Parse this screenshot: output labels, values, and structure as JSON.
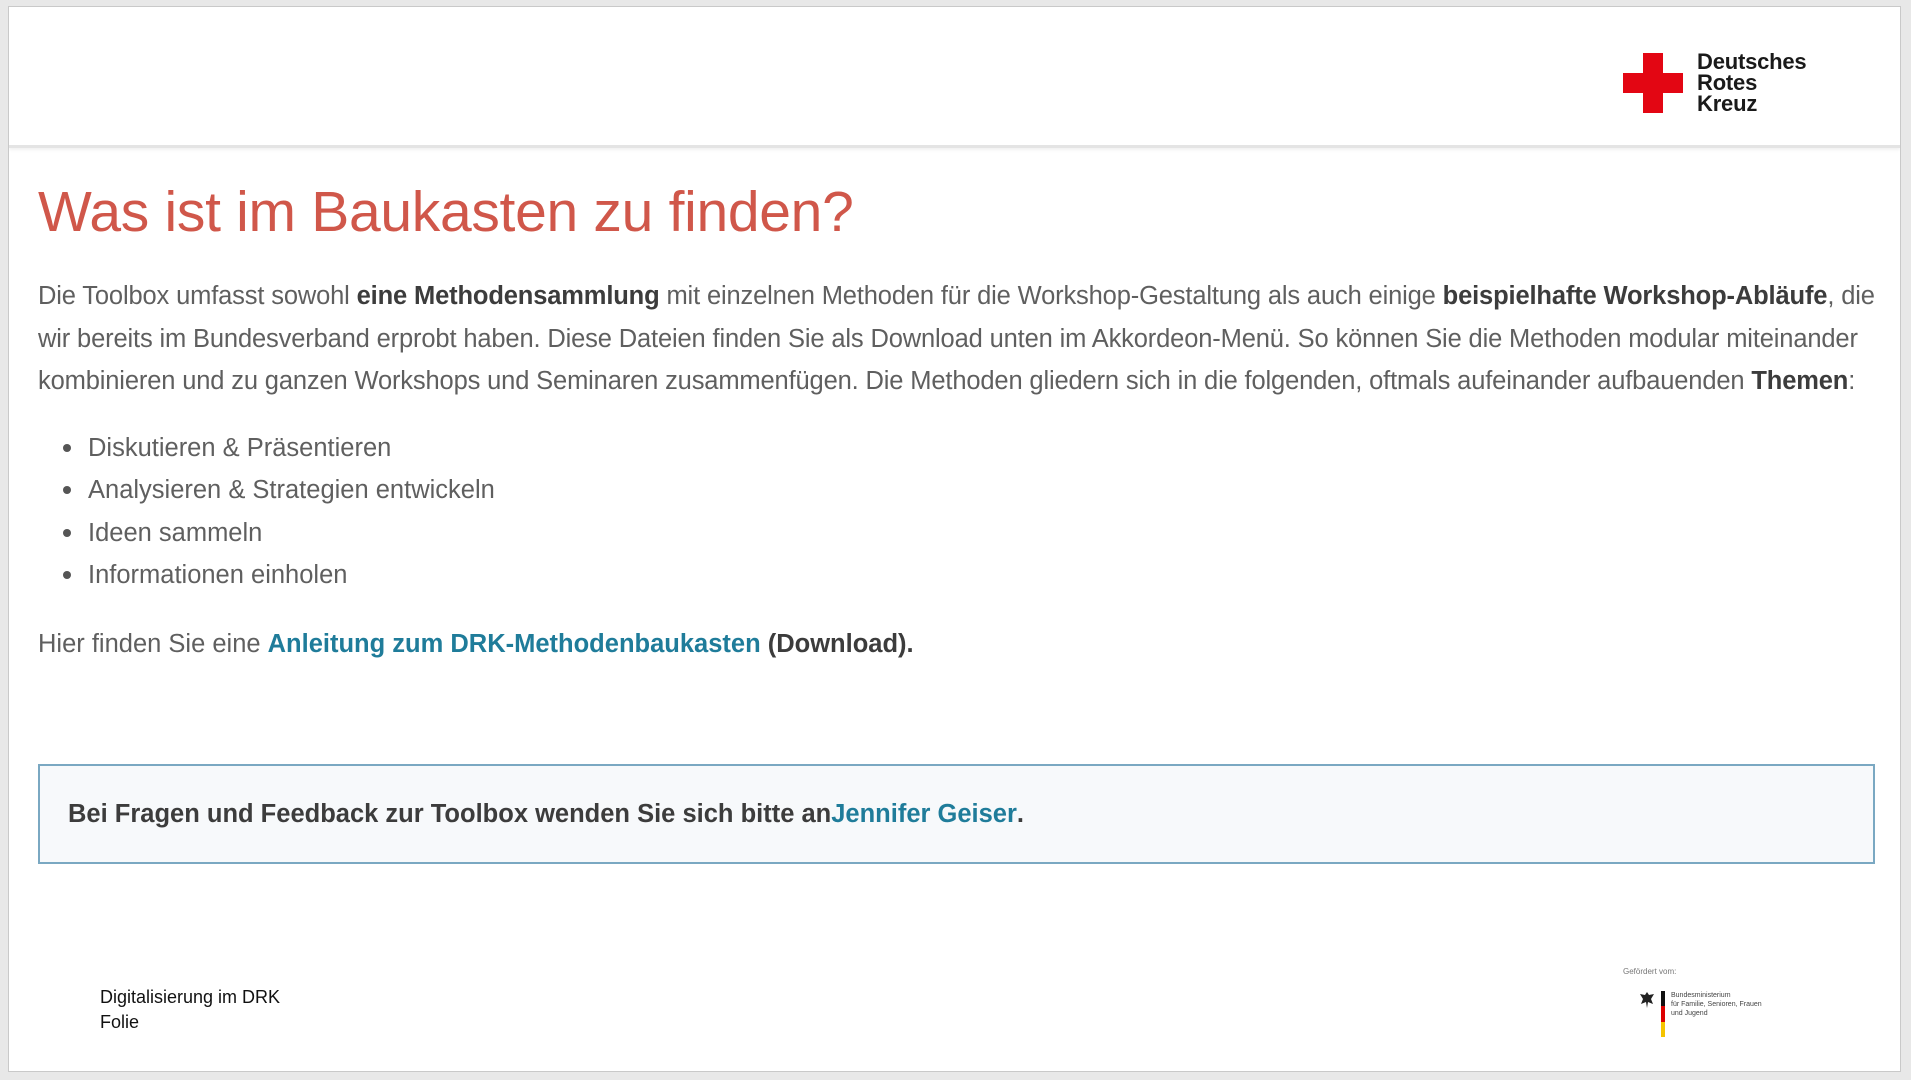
{
  "header": {
    "logo": {
      "icon": "red-cross-icon",
      "brand_color": "#e30613",
      "line1": "Deutsches",
      "line2": "Rotes",
      "line3": "Kreuz"
    }
  },
  "main": {
    "title": "Was ist im Baukasten zu finden?",
    "intro": {
      "p1": "Die Toolbox umfasst sowohl ",
      "b1": "eine Methodensammlung",
      "p2": " mit einzelnen Methoden für die Workshop-Gestaltung als auch einige ",
      "b2": "beispielhafte Workshop-Abläufe",
      "p3": ", die wir bereits im Bundesverband erprobt haben. Diese Dateien finden Sie als Download unten im Akkordeon-Menü. So können Sie die Methoden modular miteinander kombinieren und zu ganzen Workshops und Seminaren zusammenfügen. Die Methoden gliedern sich in die folgenden, oftmals aufeinander aufbauenden ",
      "b3": "Themen",
      "p4": ":"
    },
    "themes": [
      "Diskutieren & Präsentieren",
      "Analysieren & Strategien entwickeln",
      "Ideen sammeln",
      "Informationen einholen"
    ],
    "download": {
      "prefix": "Hier finden Sie eine ",
      "link": "Anleitung zum DRK-Methodenbaukasten",
      "suffix": " (Download)."
    },
    "info_box": {
      "text": "Bei Fragen und Feedback zur Toolbox wenden Sie sich bitte an ",
      "link": "Jennifer Geiser",
      "end": "."
    }
  },
  "footer": {
    "line1": "Digitalisierung im DRK",
    "line2": "Folie",
    "sponsor": {
      "caption": "Gefördert vom:",
      "ministry_line1": "Bundesministerium",
      "ministry_line2": "für Familie, Senioren, Frauen",
      "ministry_line3": "und Jugend",
      "icon": "federal-eagle-icon"
    }
  },
  "colors": {
    "title": "#d0574a",
    "link": "#1f7c9a",
    "box_border": "#7aa8c2"
  }
}
